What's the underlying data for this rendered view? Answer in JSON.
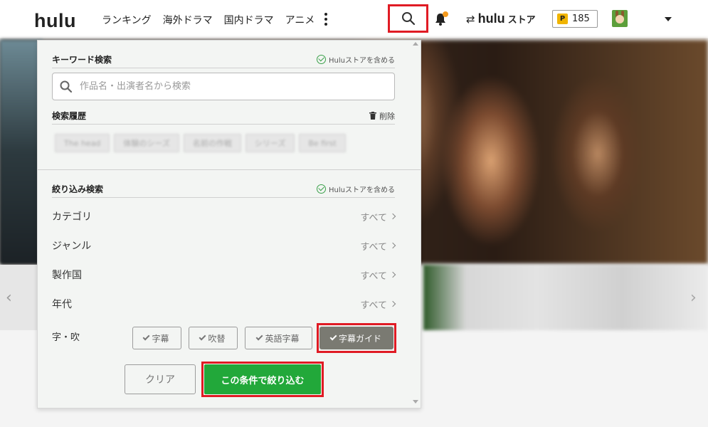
{
  "header": {
    "logo": "hulu",
    "nav": [
      "ランキング",
      "海外ドラマ",
      "国内ドラマ",
      "アニメ"
    ],
    "store_arrows": "⇄",
    "store_brand": "hulu",
    "store_suffix": "ストア",
    "points_badge": "P",
    "points_value": "185"
  },
  "panel": {
    "keyword_title": "キーワード検索",
    "include_store": "Huluストアを含める",
    "search_placeholder": "作品名・出演者名から検索",
    "history_title": "検索履歴",
    "delete_label": "削除",
    "history_chips": [
      "The head",
      "体験のシーズ",
      "名前の作戦",
      "シリーズ",
      "Be first"
    ],
    "filter_title": "絞り込み検索",
    "filter_include_store": "Huluストアを含める",
    "filters": [
      {
        "label": "カテゴリ",
        "value": "すべて"
      },
      {
        "label": "ジャンル",
        "value": "すべて"
      },
      {
        "label": "製作国",
        "value": "すべて"
      },
      {
        "label": "年代",
        "value": "すべて"
      }
    ],
    "sub_dub_label": "字・吹",
    "chips": [
      "字幕",
      "吹替",
      "英語字幕",
      "字幕ガイド"
    ],
    "clear_label": "クリア",
    "apply_label": "この条件で絞り込む"
  },
  "colors": {
    "accent_green": "#22a83a",
    "highlight_red": "#e01b24",
    "points_yellow": "#f0b400"
  }
}
